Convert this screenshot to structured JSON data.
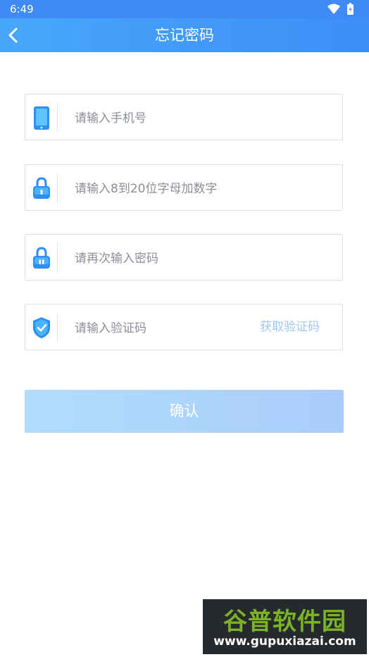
{
  "status_bar": {
    "time": "6:49"
  },
  "header": {
    "title": "忘记密码"
  },
  "form": {
    "phone_placeholder": "请输入手机号",
    "password_placeholder": "请输入8到20位字母加数字",
    "confirm_password_placeholder": "请再次输入密码",
    "code_placeholder": "请输入验证码",
    "get_code_label": "获取验证码"
  },
  "confirm_button": {
    "label": "确认"
  },
  "watermark": {
    "title": "谷普软件园",
    "url": "www.gupuxiazai.com"
  },
  "colors": {
    "header": "#3f8af5",
    "icon_blue": "#2f8ff0",
    "button": "#b2dcfb",
    "link": "#9ec7f1"
  }
}
